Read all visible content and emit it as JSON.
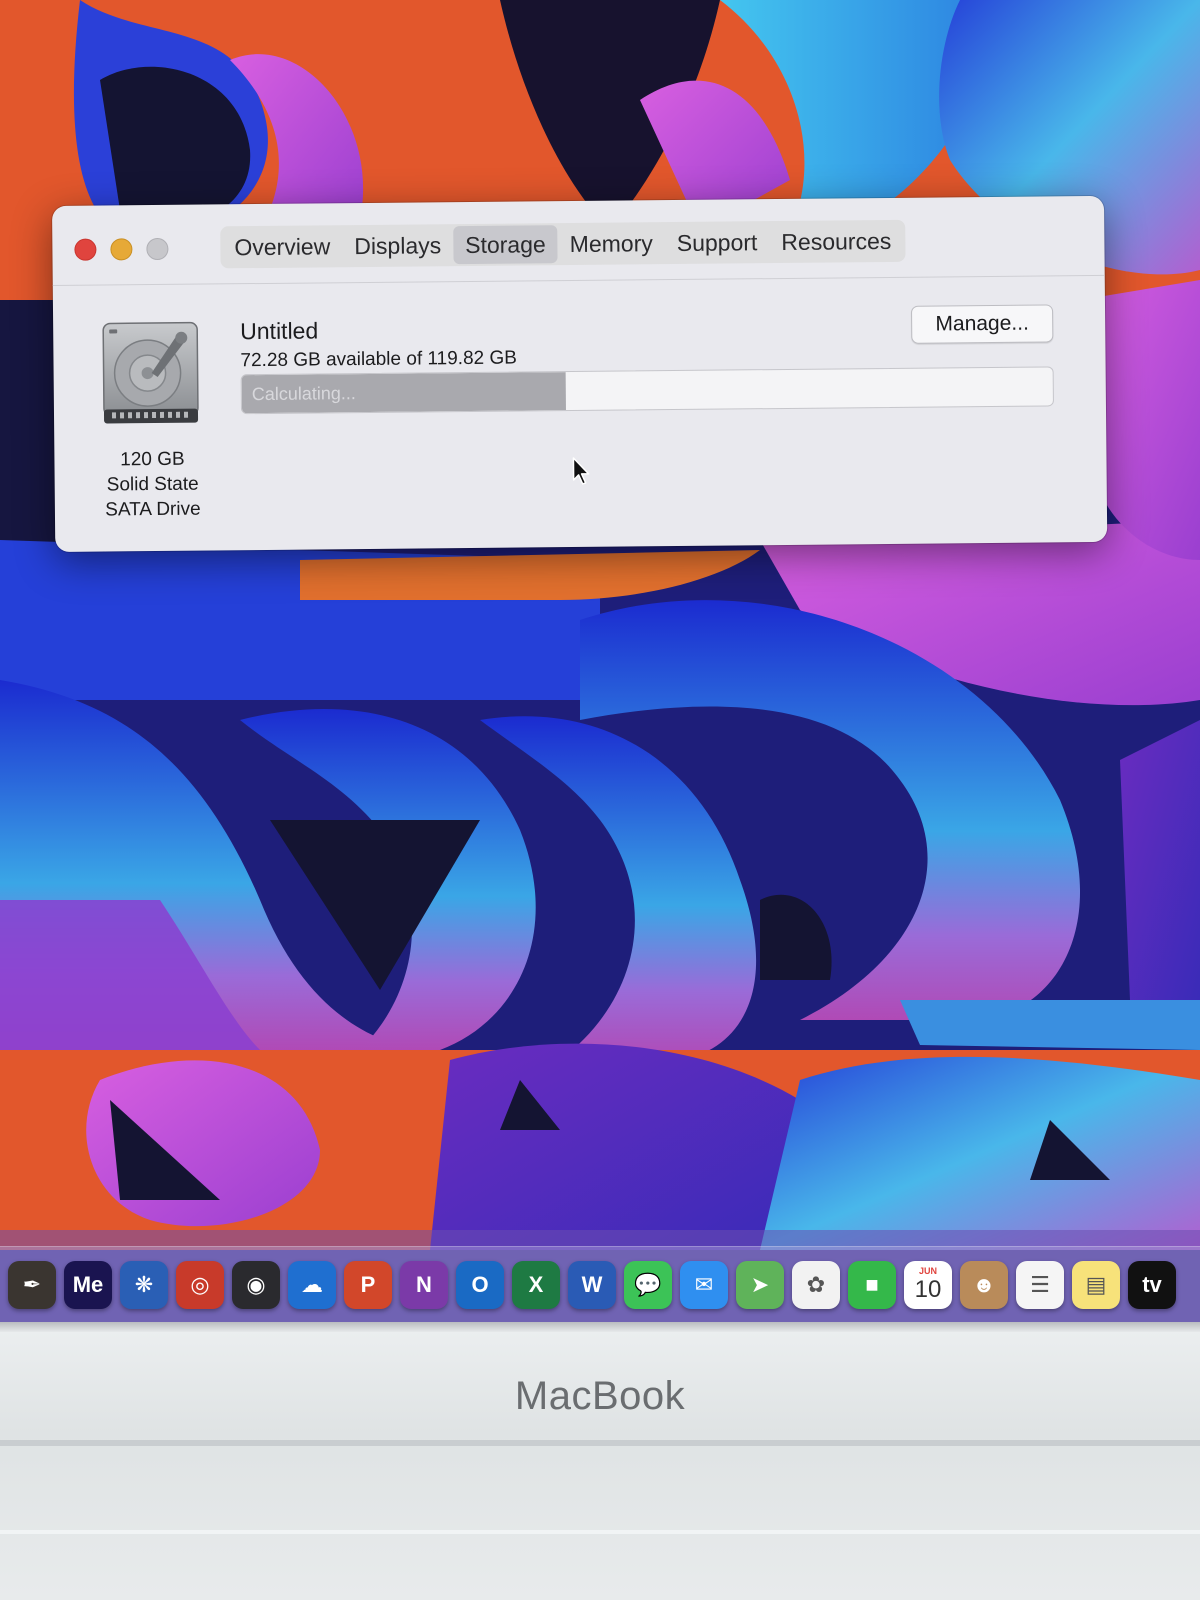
{
  "window": {
    "tabs": [
      {
        "label": "Overview"
      },
      {
        "label": "Displays"
      },
      {
        "label": "Storage",
        "active": true
      },
      {
        "label": "Memory"
      },
      {
        "label": "Support"
      },
      {
        "label": "Resources"
      }
    ],
    "drive": {
      "icon": "hard-drive-icon",
      "caption_line1": "120 GB",
      "caption_line2": "Solid State",
      "caption_line3": "SATA Drive"
    },
    "volume": {
      "name": "Untitled",
      "availability": "72.28 GB available of 119.82 GB",
      "used_fraction": 0.4,
      "bar_label": "Calculating..."
    },
    "manage_label": "Manage..."
  },
  "dock": {
    "apps": [
      {
        "name": "quill-app-icon",
        "glyph": "✒",
        "color": "#3a3530"
      },
      {
        "name": "media-encoder-icon",
        "glyph": "Me",
        "color": "#1a1450"
      },
      {
        "name": "audio-app-icon",
        "glyph": "❋",
        "color": "#2a5fb5"
      },
      {
        "name": "record-app-icon",
        "glyph": "◎",
        "color": "#c83a2a"
      },
      {
        "name": "dvd-player-icon",
        "glyph": "◉",
        "color": "#2a2a2e"
      },
      {
        "name": "onedrive-icon",
        "glyph": "☁",
        "color": "#1f6fd0"
      },
      {
        "name": "powerpoint-icon",
        "glyph": "P",
        "color": "#d2472a"
      },
      {
        "name": "onenote-icon",
        "glyph": "N",
        "color": "#7b3aa8"
      },
      {
        "name": "outlook-icon",
        "glyph": "O",
        "color": "#1a6ac4"
      },
      {
        "name": "excel-icon",
        "glyph": "X",
        "color": "#1e7a43"
      },
      {
        "name": "word-icon",
        "glyph": "W",
        "color": "#2a5bb5"
      },
      {
        "name": "messages-icon",
        "glyph": "💬",
        "color": "#3cc357"
      },
      {
        "name": "mail-icon",
        "glyph": "✉",
        "color": "#2f8ff0"
      },
      {
        "name": "maps-icon",
        "glyph": "➤",
        "color": "#5fb35a"
      },
      {
        "name": "photos-icon",
        "glyph": "✿",
        "color": "#f2f2f2"
      },
      {
        "name": "facetime-icon",
        "glyph": "■",
        "color": "#34b84a"
      },
      {
        "name": "calendar-icon",
        "glyph": "10",
        "month": "JUN",
        "color": "#ffffff"
      },
      {
        "name": "contacts-icon",
        "glyph": "☻",
        "color": "#b98b5a"
      },
      {
        "name": "reminders-icon",
        "glyph": "☰",
        "color": "#f5f5f5"
      },
      {
        "name": "notes-icon",
        "glyph": "▤",
        "color": "#f7e27a"
      },
      {
        "name": "apple-tv-icon",
        "glyph": "tv",
        "color": "#111111"
      }
    ]
  },
  "bezel": {
    "brand": "MacBook"
  }
}
